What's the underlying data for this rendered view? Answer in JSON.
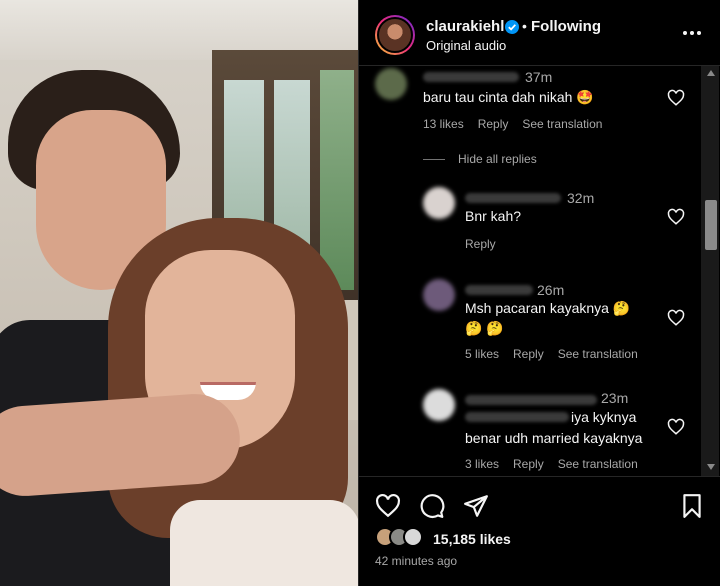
{
  "post": {
    "username": "claurakiehl",
    "follow_status": "Following",
    "audio": "Original audio",
    "separator": "•"
  },
  "comments": {
    "hide_replies": "Hide all replies",
    "items": [
      {
        "time": "37m",
        "text": "baru tau cinta dah nikah 🤩",
        "likes": "13 likes",
        "reply": "Reply",
        "translate": "See translation"
      },
      {
        "time": "32m",
        "text": "Bnr kah?",
        "reply": "Reply"
      },
      {
        "time": "26m",
        "text": "Msh pacaran kayaknya 🤔",
        "text2": "🤔 🤔",
        "likes": "5 likes",
        "reply": "Reply",
        "translate": "See translation"
      },
      {
        "time": "23m",
        "text": "iya kyknya",
        "text2": "benar udh married kayaknya",
        "likes": "3 likes",
        "reply": "Reply",
        "translate": "See translation"
      }
    ]
  },
  "footer": {
    "likes": "15,185 likes",
    "posted": "42 minutes ago"
  },
  "colors": {
    "background": "#000000",
    "text_primary": "#f5f5f5",
    "text_secondary": "#a8a8a8",
    "verified": "#0095f6"
  }
}
